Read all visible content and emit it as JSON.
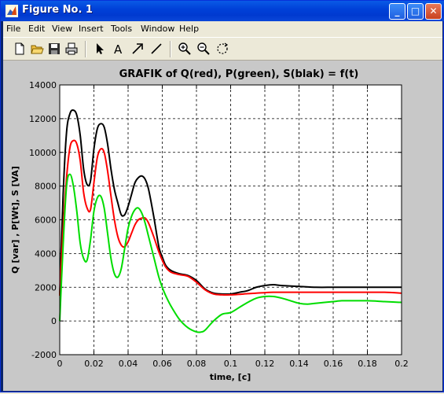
{
  "window": {
    "title": "Figure No. 1"
  },
  "titlebar_buttons": {
    "minimize": "_",
    "maximize": "□",
    "close": "✕"
  },
  "menu": [
    "File",
    "Edit",
    "View",
    "Insert",
    "Tools",
    "Window",
    "Help"
  ],
  "toolbar": [
    "new-file-icon",
    "open-folder-icon",
    "save-icon",
    "print-icon",
    "select-arrow-icon",
    "text-tool-icon",
    "arrow-tool-icon",
    "line-tool-icon",
    "zoom-in-icon",
    "zoom-out-icon",
    "rotate-icon"
  ],
  "chart_data": {
    "type": "line",
    "title": "GRAFIK of  Q(red), P(green), S(blak) = f(t)",
    "xlabel": "time, [c]",
    "ylabel": "Q [var] , P[Wt], S [VA]",
    "xlim": [
      0,
      0.2
    ],
    "ylim": [
      -2000,
      14000
    ],
    "xticks": [
      "0",
      "0.02",
      "0.04",
      "0.06",
      "0.08",
      "0.1",
      "0.12",
      "0.14",
      "0.16",
      "0.18",
      "0.2"
    ],
    "yticks": [
      "-2000",
      "0",
      "2000",
      "4000",
      "6000",
      "8000",
      "10000",
      "12000",
      "14000"
    ],
    "grid": true,
    "series": [
      {
        "color": "#000000",
        "x": [
          0,
          0.002,
          0.004,
          0.006,
          0.008,
          0.01,
          0.012,
          0.014,
          0.016,
          0.018,
          0.02,
          0.022,
          0.024,
          0.026,
          0.028,
          0.03,
          0.032,
          0.034,
          0.036,
          0.038,
          0.04,
          0.042,
          0.044,
          0.046,
          0.048,
          0.05,
          0.052,
          0.055,
          0.058,
          0.06,
          0.062,
          0.065,
          0.07,
          0.075,
          0.08,
          0.085,
          0.09,
          0.095,
          0.1,
          0.105,
          0.11,
          0.115,
          0.12,
          0.125,
          0.13,
          0.14,
          0.15,
          0.16,
          0.17,
          0.18,
          0.19,
          0.2
        ],
        "y": [
          1500,
          7500,
          11200,
          12300,
          12500,
          12200,
          11000,
          9000,
          8100,
          8300,
          10200,
          11400,
          11700,
          11500,
          10500,
          9000,
          7800,
          7000,
          6300,
          6300,
          6800,
          7500,
          8200,
          8500,
          8600,
          8400,
          7800,
          6200,
          4400,
          3800,
          3300,
          3000,
          2800,
          2700,
          2400,
          1900,
          1650,
          1600,
          1600,
          1700,
          1800,
          2000,
          2100,
          2150,
          2100,
          2050,
          2000,
          2000,
          2000,
          2000,
          2000,
          2000
        ]
      },
      {
        "color": "#ff0000",
        "x": [
          0,
          0.002,
          0.004,
          0.006,
          0.008,
          0.01,
          0.012,
          0.014,
          0.016,
          0.018,
          0.02,
          0.022,
          0.024,
          0.026,
          0.028,
          0.03,
          0.032,
          0.034,
          0.036,
          0.038,
          0.04,
          0.042,
          0.044,
          0.046,
          0.048,
          0.05,
          0.052,
          0.055,
          0.058,
          0.06,
          0.062,
          0.065,
          0.07,
          0.075,
          0.08,
          0.085,
          0.09,
          0.095,
          0.1,
          0.105,
          0.11,
          0.115,
          0.12,
          0.125,
          0.13,
          0.14,
          0.15,
          0.16,
          0.17,
          0.18,
          0.19,
          0.2
        ],
        "y": [
          1500,
          5500,
          8500,
          10300,
          10700,
          10500,
          9500,
          7600,
          6700,
          6600,
          8200,
          9700,
          10200,
          10000,
          8900,
          7400,
          6000,
          5000,
          4500,
          4400,
          4700,
          5200,
          5700,
          6000,
          6100,
          6100,
          5800,
          5000,
          4100,
          3600,
          3200,
          2900,
          2750,
          2650,
          2300,
          1850,
          1600,
          1550,
          1550,
          1580,
          1620,
          1650,
          1680,
          1700,
          1700,
          1700,
          1700,
          1700,
          1700,
          1700,
          1700,
          1650
        ]
      },
      {
        "color": "#00dd00",
        "x": [
          0,
          0.002,
          0.004,
          0.006,
          0.008,
          0.01,
          0.012,
          0.014,
          0.016,
          0.018,
          0.02,
          0.022,
          0.024,
          0.026,
          0.028,
          0.03,
          0.032,
          0.034,
          0.036,
          0.038,
          0.04,
          0.042,
          0.044,
          0.046,
          0.048,
          0.05,
          0.052,
          0.055,
          0.058,
          0.06,
          0.062,
          0.065,
          0.07,
          0.075,
          0.08,
          0.083,
          0.085,
          0.09,
          0.095,
          0.1,
          0.105,
          0.11,
          0.115,
          0.12,
          0.125,
          0.13,
          0.135,
          0.14,
          0.145,
          0.15,
          0.155,
          0.16,
          0.165,
          0.17,
          0.18,
          0.19,
          0.2
        ],
        "y": [
          0,
          4500,
          8000,
          8700,
          8000,
          6500,
          4600,
          3700,
          3600,
          4800,
          6500,
          7300,
          7400,
          6700,
          5200,
          3700,
          2800,
          2600,
          3100,
          4300,
          5500,
          6200,
          6600,
          6700,
          6400,
          5800,
          5000,
          3800,
          2600,
          2000,
          1500,
          900,
          100,
          -400,
          -650,
          -650,
          -550,
          0,
          400,
          500,
          800,
          1100,
          1350,
          1450,
          1450,
          1350,
          1200,
          1050,
          1000,
          1050,
          1100,
          1150,
          1200,
          1200,
          1200,
          1150,
          1100
        ]
      }
    ]
  }
}
